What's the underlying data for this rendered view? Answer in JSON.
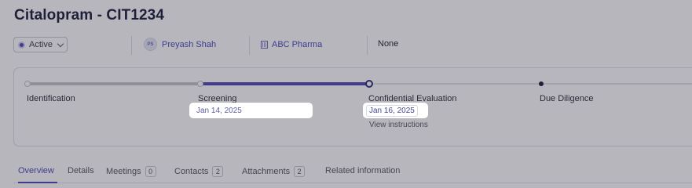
{
  "title": "Citalopram - CIT1234",
  "meta": {
    "status": {
      "label": "Active"
    },
    "owner": {
      "initials": "PS",
      "name": "Preyash Shah"
    },
    "company": {
      "name": "ABC Pharma"
    },
    "extra": "None"
  },
  "stages": [
    {
      "label": "Identification",
      "date": ""
    },
    {
      "label": "Screening",
      "date": "Jan 14, 2025"
    },
    {
      "label": "Confidential Evaluation",
      "date": "Jan 16, 2025",
      "link": "View instructions"
    },
    {
      "label": "Due Diligence",
      "date": ""
    }
  ],
  "tabs": [
    {
      "label": "Overview",
      "count": ""
    },
    {
      "label": "Details",
      "count": ""
    },
    {
      "label": "Meetings",
      "count": "0"
    },
    {
      "label": "Contacts",
      "count": "2"
    },
    {
      "label": "Attachments",
      "count": "2"
    },
    {
      "label": "Related information",
      "count": ""
    }
  ],
  "colors": {
    "accent": "#4b47b8",
    "title": "#1b1b3a",
    "overlay": "rgba(40,40,60,0.34)"
  }
}
